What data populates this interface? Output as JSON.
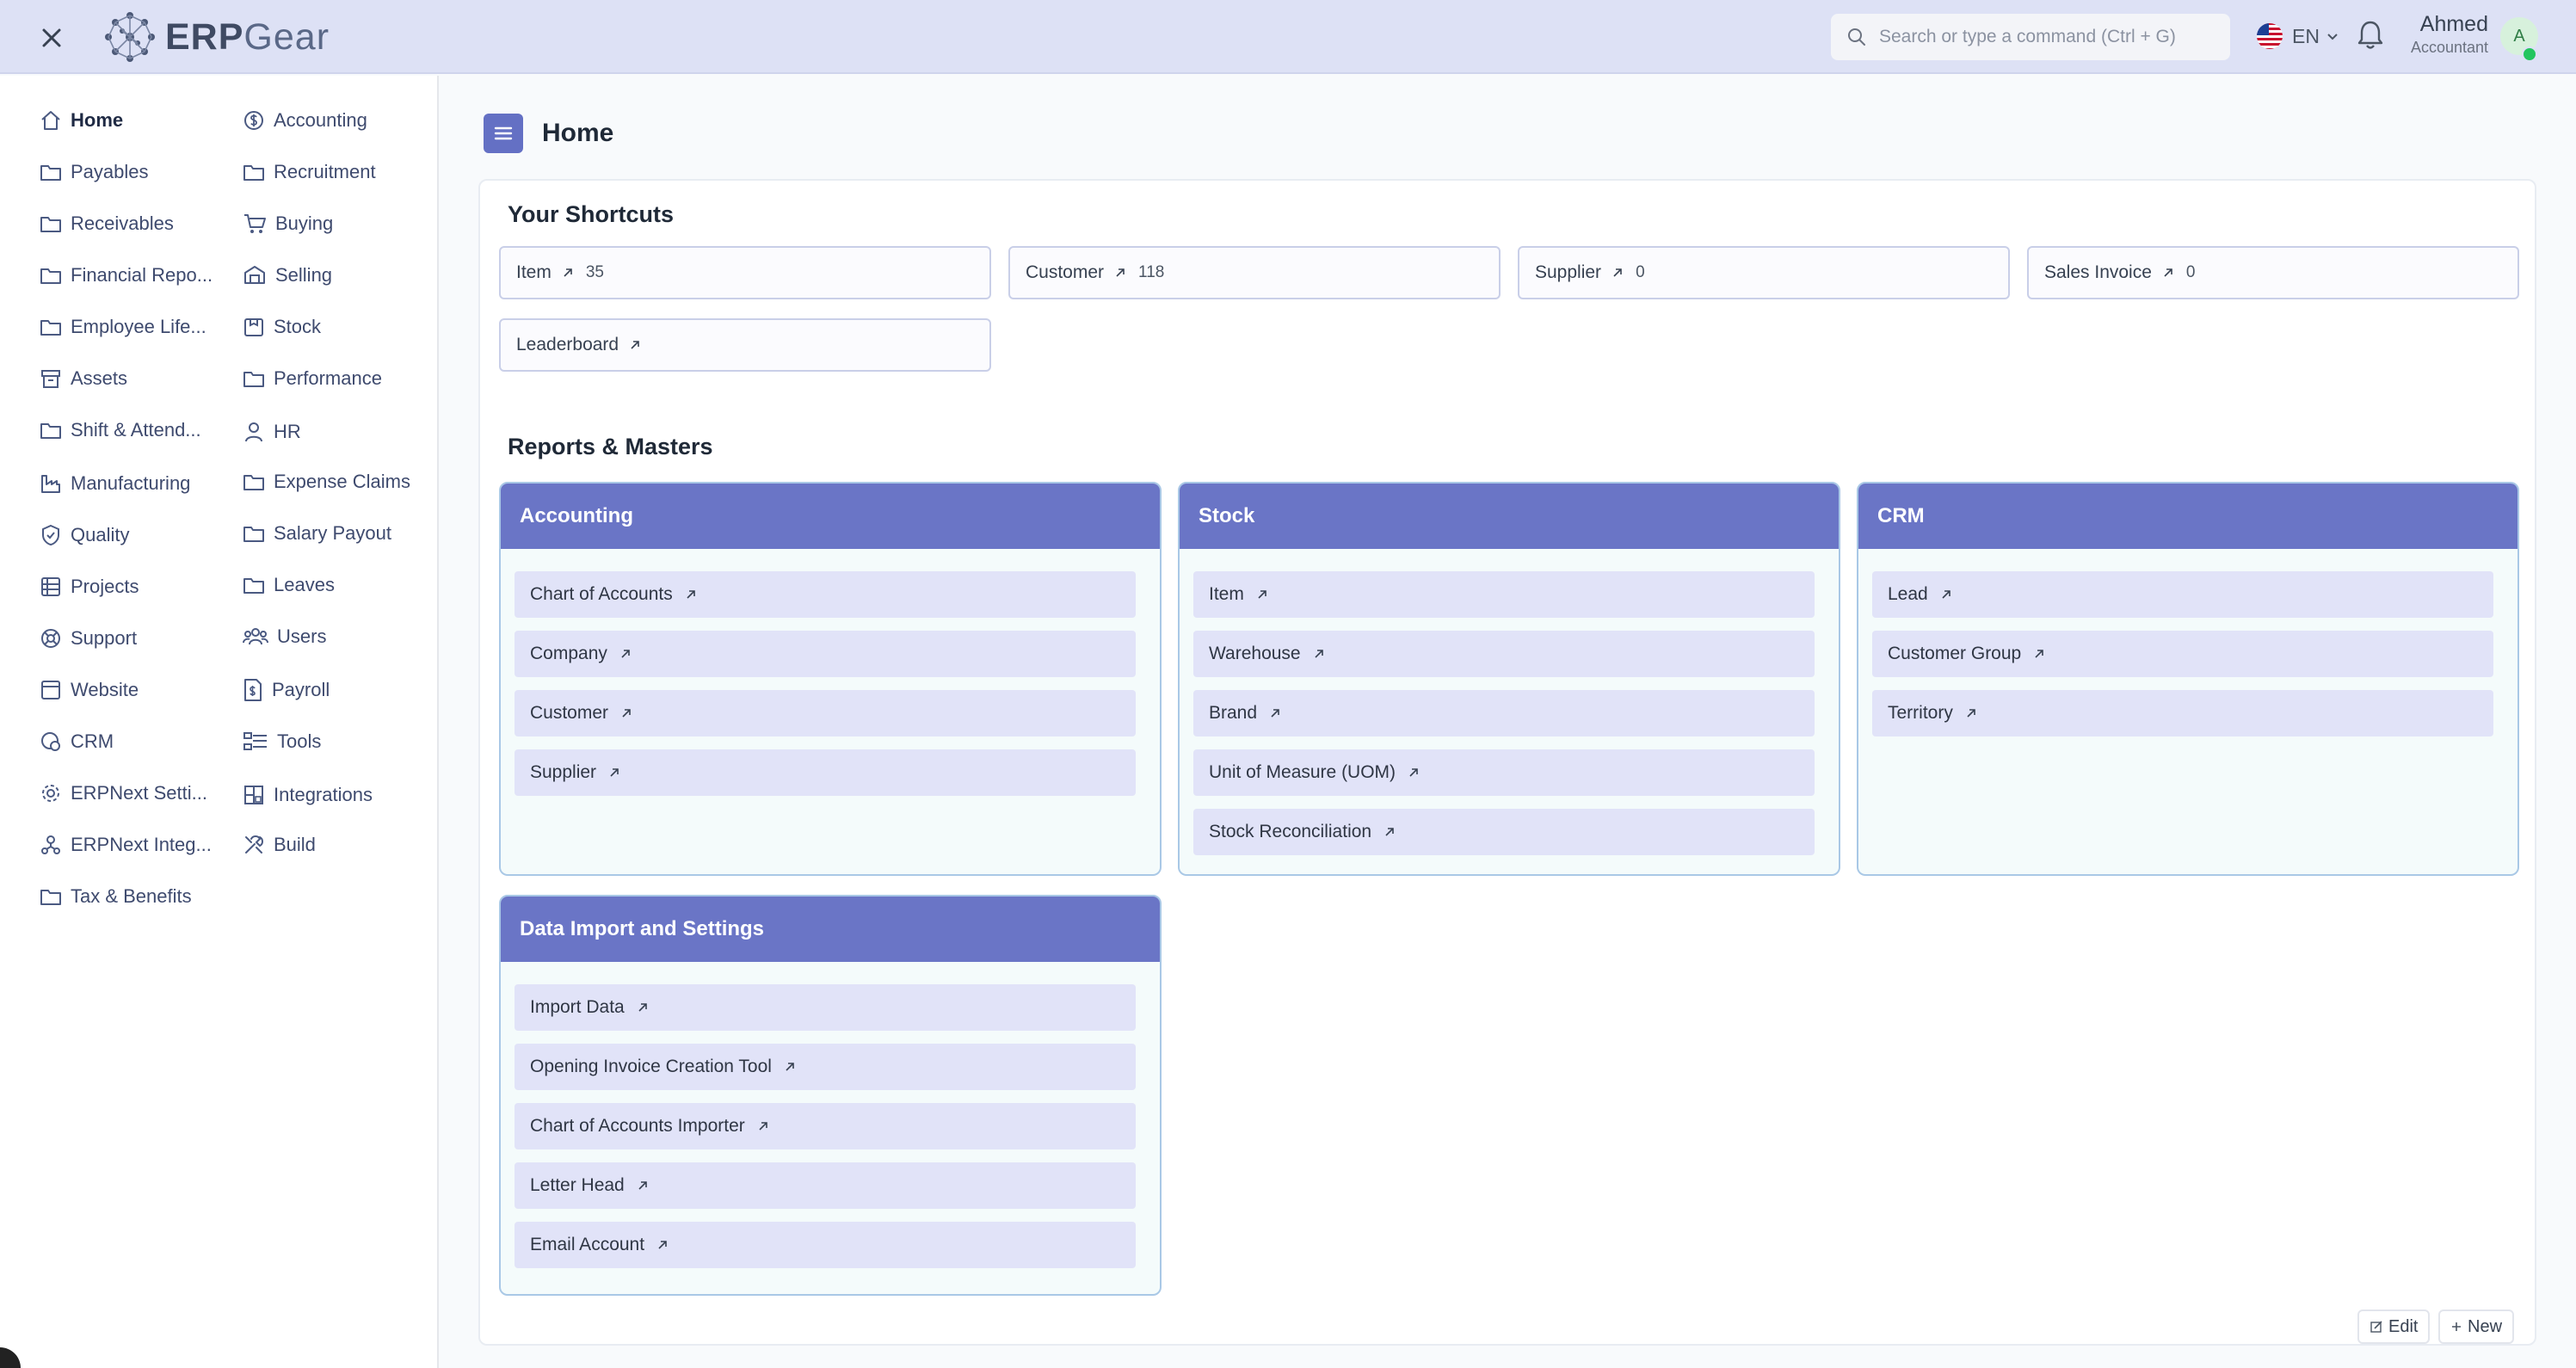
{
  "header": {
    "logo_text_main": "ERP",
    "logo_text_accent": "Gear",
    "search_placeholder": "Search or type a command (Ctrl + G)",
    "language": "EN",
    "user_name": "Ahmed",
    "user_role": "Accountant",
    "avatar_initial": "A"
  },
  "sidebar": {
    "left_column": [
      {
        "label": "Home",
        "icon": "home-icon"
      },
      {
        "label": "Payables",
        "icon": "folder-icon"
      },
      {
        "label": "Receivables",
        "icon": "folder-icon"
      },
      {
        "label": "Financial Repo...",
        "icon": "folder-icon"
      },
      {
        "label": "Employee Life...",
        "icon": "folder-icon"
      },
      {
        "label": "Assets",
        "icon": "archive-icon"
      },
      {
        "label": "Shift & Attend...",
        "icon": "folder-icon"
      },
      {
        "label": "Manufacturing",
        "icon": "factory-icon"
      },
      {
        "label": "Quality",
        "icon": "shield-check-icon"
      },
      {
        "label": "Projects",
        "icon": "list-icon"
      },
      {
        "label": "Support",
        "icon": "support-icon"
      },
      {
        "label": "Website",
        "icon": "browser-icon"
      },
      {
        "label": "CRM",
        "icon": "crm-icon"
      },
      {
        "label": "ERPNext Setti...",
        "icon": "settings-icon"
      },
      {
        "label": "ERPNext Integ...",
        "icon": "integration-icon"
      },
      {
        "label": "Tax & Benefits",
        "icon": "folder-icon"
      }
    ],
    "right_column": [
      {
        "label": "Accounting",
        "icon": "dollar-icon"
      },
      {
        "label": "Recruitment",
        "icon": "folder-icon"
      },
      {
        "label": "Buying",
        "icon": "cart-icon"
      },
      {
        "label": "Selling",
        "icon": "selling-icon"
      },
      {
        "label": "Stock",
        "icon": "box-icon"
      },
      {
        "label": "Performance",
        "icon": "folder-icon"
      },
      {
        "label": "HR",
        "icon": "hr-icon"
      },
      {
        "label": "Expense Claims",
        "icon": "folder-icon"
      },
      {
        "label": "Salary Payout",
        "icon": "folder-icon"
      },
      {
        "label": "Leaves",
        "icon": "folder-icon"
      },
      {
        "label": "Users",
        "icon": "users-icon"
      },
      {
        "label": "Payroll",
        "icon": "payroll-icon"
      },
      {
        "label": "Tools",
        "icon": "tools-icon"
      },
      {
        "label": "Integrations",
        "icon": "integrations-icon"
      },
      {
        "label": "Build",
        "icon": "build-icon"
      }
    ]
  },
  "main": {
    "page_title": "Home",
    "shortcuts_title": "Your Shortcuts",
    "shortcuts": [
      {
        "label": "Item",
        "count": "35"
      },
      {
        "label": "Customer",
        "count": "118"
      },
      {
        "label": "Supplier",
        "count": "0"
      },
      {
        "label": "Sales Invoice",
        "count": "0"
      },
      {
        "label": "Leaderboard",
        "count": ""
      }
    ],
    "reports_title": "Reports & Masters",
    "groups": [
      {
        "title": "Accounting",
        "links": [
          "Chart of Accounts",
          "Company",
          "Customer",
          "Supplier"
        ]
      },
      {
        "title": "Stock",
        "links": [
          "Item",
          "Warehouse",
          "Brand",
          "Unit of Measure (UOM)",
          "Stock Reconciliation"
        ]
      },
      {
        "title": "CRM",
        "links": [
          "Lead",
          "Customer Group",
          "Territory"
        ]
      },
      {
        "title": "Data Import and Settings",
        "links": [
          "Import Data",
          "Opening Invoice Creation Tool",
          "Chart of Accounts Importer",
          "Letter Head",
          "Email Account"
        ]
      }
    ],
    "edit_label": "Edit",
    "new_label": "New"
  }
}
